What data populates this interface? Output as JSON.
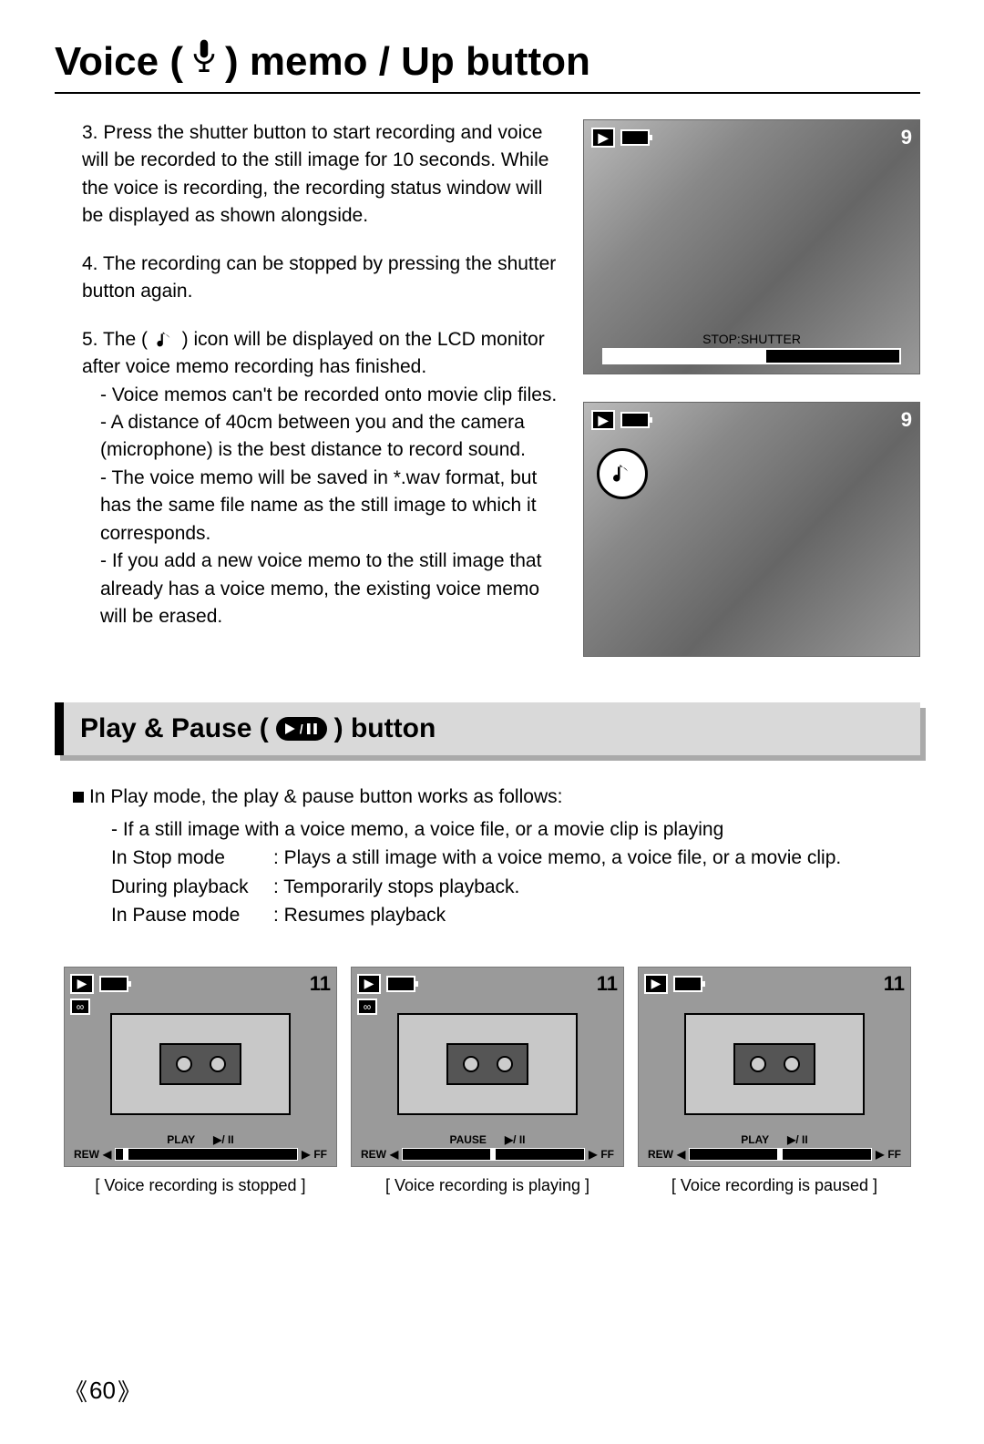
{
  "title": {
    "part1": "Voice (",
    "part2": ") memo / Up button"
  },
  "steps": {
    "s3": "3. Press the shutter button to start recording and voice will be recorded to the still image for 10 seconds. While the voice is recording, the recording status window will be displayed as shown alongside.",
    "s4": "4. The recording can be stopped by pressing the shutter button again.",
    "s5_intro": "5. The (",
    "s5_rest": ") icon will be displayed on the LCD monitor after voice memo recording has finished.",
    "b1": "- Voice memos can't be recorded onto movie clip files.",
    "b2": "- A distance of 40cm between you and the camera (microphone) is the best distance to record sound.",
    "b3": "- The voice memo will be saved in *.wav format, but has the same file name as the still image to which it corresponds.",
    "b4": "- If you add a new voice memo to the still image that already has a voice memo, the existing voice memo will be erased."
  },
  "screen1": {
    "count": "9",
    "stop_label": "STOP:SHUTTER"
  },
  "screen2": {
    "count": "9"
  },
  "section2": {
    "title_part1": "Play & Pause (",
    "title_part2": ") button"
  },
  "playsection": {
    "intro": "In Play mode, the play & pause button works as follows:",
    "cond": "- If a still image with a voice memo, a voice file, or a movie clip is playing",
    "mode1_label": "In Stop mode",
    "mode1_desc": ": Plays a still image with a voice memo, a voice file, or a movie clip.",
    "mode2_label": "During playback",
    "mode2_desc": ": Temporarily stops playback.",
    "mode3_label": "In Pause mode",
    "mode3_desc": ": Resumes playback"
  },
  "pscreens": [
    {
      "count": "11",
      "status": "PLAY",
      "rew": "REW",
      "ff": "FF",
      "caption": "[ Voice recording is stopped ]",
      "mark_pos": "4%"
    },
    {
      "count": "11",
      "status": "PAUSE",
      "rew": "REW",
      "ff": "FF",
      "caption": "[ Voice recording is playing ]",
      "mark_pos": "48%"
    },
    {
      "count": "11",
      "status": "PLAY",
      "rew": "REW",
      "ff": "FF",
      "caption": "[ Voice recording is paused ]",
      "mark_pos": "48%"
    }
  ],
  "page_number": "60",
  "controls_icon": "▶/ II"
}
